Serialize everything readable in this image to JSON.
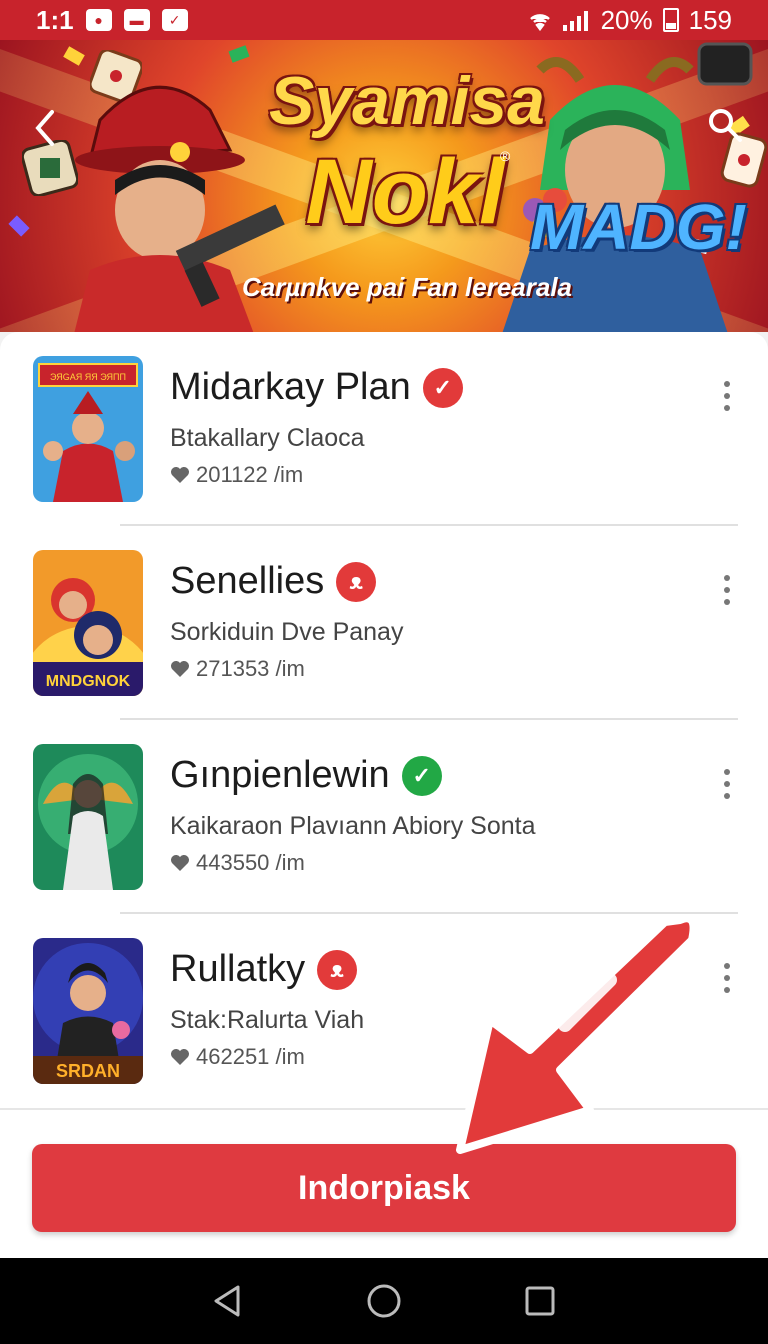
{
  "status_bar": {
    "left_text": "1:1",
    "battery": "20%",
    "time": "159"
  },
  "banner": {
    "title_line1": "Syamisa",
    "title_line2": "Nokl",
    "registered": "®",
    "title_line3": "MADG!",
    "subtitle": "Carµnkve pai Fan lerearala"
  },
  "items": [
    {
      "title": "Midarkay Plan",
      "subtitle": "Btakallary Claoca",
      "meta": "201122 /im",
      "badge": "✓",
      "badge_color": "red",
      "thumb_label": "ЭЯGAЯ ЯЯ ЭЯПП"
    },
    {
      "title": "Senellies",
      "subtitle": "Sorkiduin Dve Panay",
      "meta": "271353 /im",
      "badge": "ᴥ",
      "badge_color": "red",
      "thumb_label": "MNDGNOK"
    },
    {
      "title": "Gınpienlewin",
      "subtitle": "Kaikaraon Plavıann Abiory Sonta",
      "meta": "443550 /im",
      "badge": "✓",
      "badge_color": "green",
      "thumb_label": ""
    },
    {
      "title": "Rullatky",
      "subtitle": "Stak:Ralurta Viah",
      "meta": "462251 /im",
      "badge": "ᴥ",
      "badge_color": "red",
      "thumb_label": "SRDAN"
    }
  ],
  "action": {
    "label": "Indorpiask"
  },
  "colors": {
    "brand_red": "#c8232c",
    "button_red": "#df3a40",
    "green_badge": "#22a845"
  },
  "icons": [
    "back-icon",
    "search-icon",
    "heart-icon",
    "more-icon",
    "nav-back-icon",
    "nav-home-icon",
    "nav-recents-icon"
  ]
}
